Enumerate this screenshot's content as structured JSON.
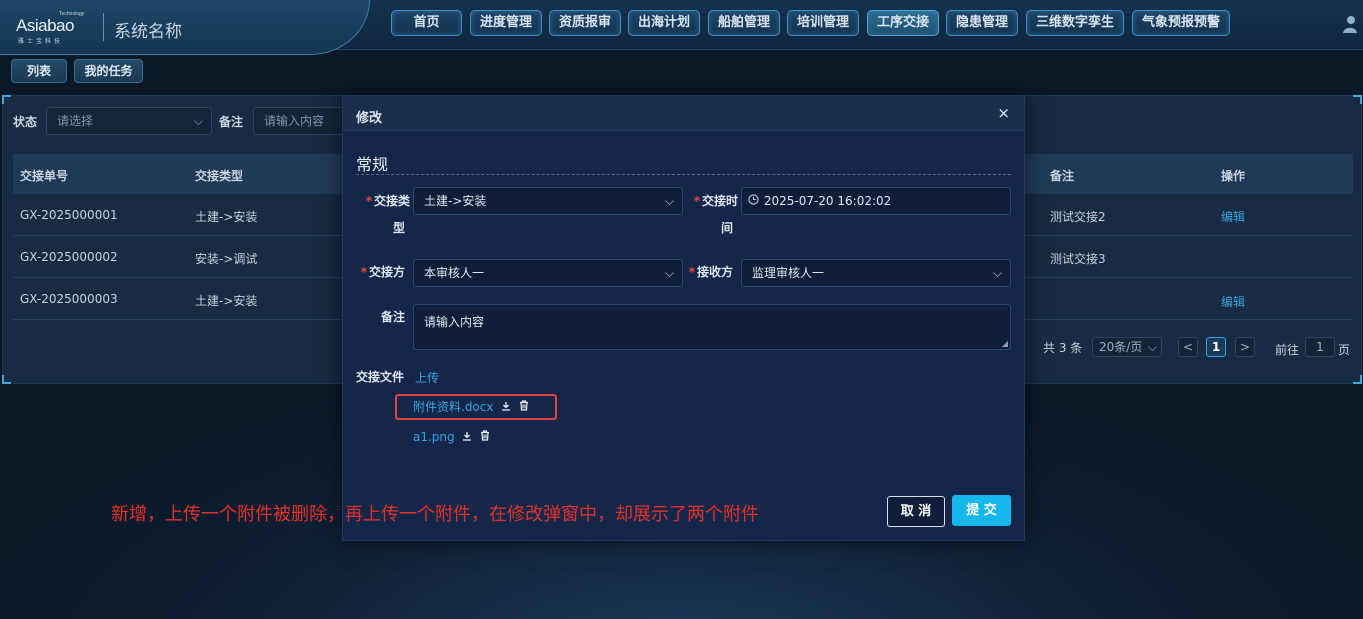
{
  "header": {
    "logo_tech": "Technology",
    "logo_main": "Asiabao",
    "logo_sub": "雅士宝科技",
    "system_title": "系统名称",
    "nav": [
      "首页",
      "进度管理",
      "资质报审",
      "出海计划",
      "船舶管理",
      "培训管理",
      "工序交接",
      "隐患管理",
      "三维数字孪生",
      "气象预报预警"
    ],
    "active_nav": "工序交接",
    "user_icon": "user-icon"
  },
  "subtabs": [
    "列表",
    "我的任务"
  ],
  "filters": {
    "status_label": "状态",
    "status_placeholder": "请选择",
    "remark_label": "备注",
    "remark_placeholder": "请输入内容"
  },
  "table": {
    "headers": {
      "no": "交接单号",
      "type": "交接类型",
      "remark": "备注",
      "action": "操作"
    },
    "rows": [
      {
        "no": "GX-2025000001",
        "type": "土建->安装",
        "remark": "测试交接2",
        "action": "编辑"
      },
      {
        "no": "GX-2025000002",
        "type": "安装->调试",
        "remark": "测试交接3",
        "action": ""
      },
      {
        "no": "GX-2025000003",
        "type": "土建->安装",
        "remark": "",
        "action": "编辑"
      }
    ]
  },
  "pager": {
    "total": "共 3 条",
    "page_size": "20条/页",
    "prev": "<",
    "current": "1",
    "next": ">",
    "goto_label": "前往",
    "goto_value": "1",
    "page_suffix": "页"
  },
  "modal": {
    "title": "修改",
    "close": "×",
    "section": "常规",
    "fields": {
      "type_label_1": "交接类",
      "type_label_2": "型",
      "type_value": "土建->安装",
      "time_label_1": "交接时",
      "time_label_2": "间",
      "time_value": "2025-07-20 16:02:02",
      "from_label": "交接方",
      "from_value": "本审核人一",
      "to_label": "接收方",
      "to_value": "监理审核人一",
      "remark_label": "备注",
      "remark_placeholder": "请输入内容"
    },
    "files_label": "交接文件",
    "upload_label": "上传",
    "files": [
      {
        "name": "附件资料.docx"
      },
      {
        "name": "a1.png"
      }
    ],
    "cancel": "取 消",
    "submit": "提 交"
  },
  "annotation": "新增，上传一个附件被删除，再上传一个附件，在修改弹窗中，却展示了两个附件",
  "colors": {
    "accent": "#16b7ea",
    "link": "#3aa3e0",
    "required": "#e8483d",
    "annotation": "#e6312a"
  }
}
